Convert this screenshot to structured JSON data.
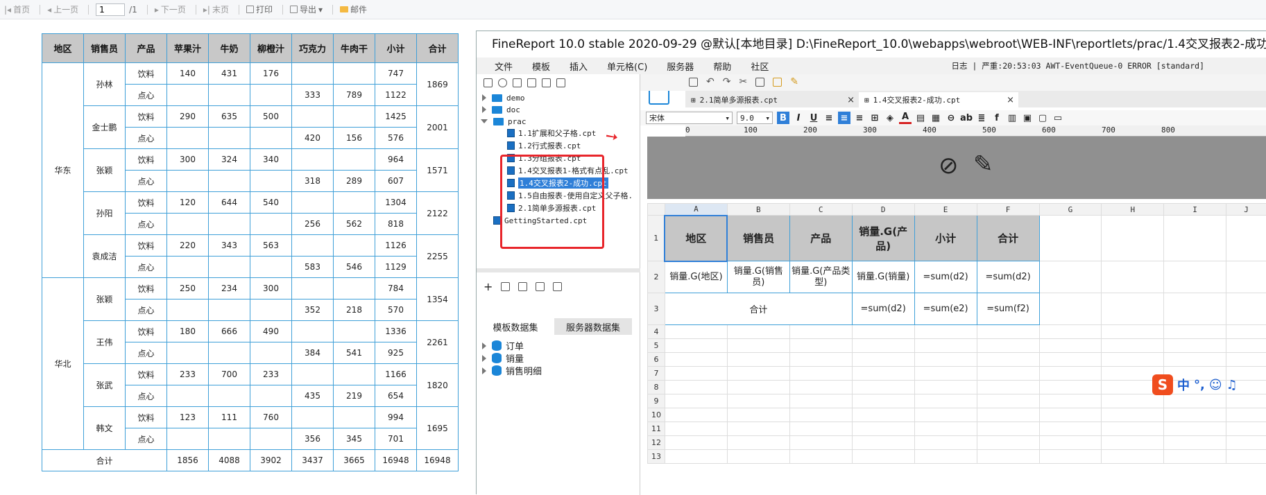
{
  "toolbar": {
    "first": "首页",
    "prev": "上一页",
    "page": "1",
    "total": "/1",
    "next": "下一页",
    "last": "末页",
    "print": "打印",
    "export": "导出",
    "mail": "邮件"
  },
  "report": {
    "headers": [
      "地区",
      "销售员",
      "产品",
      "苹果汁",
      "牛奶",
      "柳橙汁",
      "巧克力",
      "牛肉干",
      "小计",
      "合计"
    ],
    "regions": [
      {
        "name": "华东",
        "people": [
          {
            "name": "孙林",
            "total": "1869",
            "rows": [
              [
                "饮料",
                "140",
                "431",
                "176",
                "",
                "",
                "747"
              ],
              [
                "点心",
                "",
                "",
                "",
                "333",
                "789",
                "1122"
              ]
            ]
          },
          {
            "name": "金士鹏",
            "total": "2001",
            "rows": [
              [
                "饮料",
                "290",
                "635",
                "500",
                "",
                "",
                "1425"
              ],
              [
                "点心",
                "",
                "",
                "",
                "420",
                "156",
                "576"
              ]
            ]
          },
          {
            "name": "张颖",
            "total": "1571",
            "rows": [
              [
                "饮料",
                "300",
                "324",
                "340",
                "",
                "",
                "964"
              ],
              [
                "点心",
                "",
                "",
                "",
                "318",
                "289",
                "607"
              ]
            ]
          },
          {
            "name": "孙阳",
            "total": "2122",
            "rows": [
              [
                "饮料",
                "120",
                "644",
                "540",
                "",
                "",
                "1304"
              ],
              [
                "点心",
                "",
                "",
                "",
                "256",
                "562",
                "818"
              ]
            ]
          },
          {
            "name": "袁成洁",
            "total": "2255",
            "rows": [
              [
                "饮料",
                "220",
                "343",
                "563",
                "",
                "",
                "1126"
              ],
              [
                "点心",
                "",
                "",
                "",
                "583",
                "546",
                "1129"
              ]
            ]
          }
        ]
      },
      {
        "name": "华北",
        "people": [
          {
            "name": "张颖",
            "total": "1354",
            "rows": [
              [
                "饮料",
                "250",
                "234",
                "300",
                "",
                "",
                "784"
              ],
              [
                "点心",
                "",
                "",
                "",
                "352",
                "218",
                "570"
              ]
            ]
          },
          {
            "name": "王伟",
            "total": "2261",
            "rows": [
              [
                "饮料",
                "180",
                "666",
                "490",
                "",
                "",
                "1336"
              ],
              [
                "点心",
                "",
                "",
                "",
                "384",
                "541",
                "925"
              ]
            ]
          },
          {
            "name": "张武",
            "total": "1820",
            "rows": [
              [
                "饮料",
                "233",
                "700",
                "233",
                "",
                "",
                "1166"
              ],
              [
                "点心",
                "",
                "",
                "",
                "435",
                "219",
                "654"
              ]
            ]
          },
          {
            "name": "韩文",
            "total": "1695",
            "rows": [
              [
                "饮料",
                "123",
                "111",
                "760",
                "",
                "",
                "994"
              ],
              [
                "点心",
                "",
                "",
                "",
                "356",
                "345",
                "701"
              ]
            ]
          }
        ]
      }
    ],
    "footer": {
      "label": "合计",
      "values": [
        "1856",
        "4088",
        "3902",
        "3437",
        "3665",
        "16948",
        "16948"
      ]
    }
  },
  "designer": {
    "title": "FineReport 10.0 stable 2020-09-29 @默认[本地目录]     D:\\FineReport_10.0\\webapps\\webroot\\WEB-INF\\reportlets/prac/1.4交叉报表2-成功.cpt",
    "menus": [
      "文件",
      "模板",
      "插入",
      "单元格(C)",
      "服务器",
      "帮助",
      "社区"
    ],
    "status": "日志 | 严重:20:53:03 AWT-EventQueue-0 ERROR [standard]",
    "tree": {
      "folders": [
        "demo",
        "doc",
        "prac"
      ],
      "files": [
        "1.1扩展和父子格.cpt",
        "1.2行式报表.cpt",
        "1.3分组报表.cpt",
        "1.4交叉报表1-格式有点乱.cpt",
        "1.4交叉报表2-成功.cpt",
        "1.5自由报表-使用自定义父子格.",
        "2.1简单多源报表.cpt"
      ],
      "root_file": "GettingStarted.cpt"
    },
    "dataset_tabs": [
      "模板数据集",
      "服务器数据集"
    ],
    "datasets": [
      "订单",
      "销量",
      "销售明细"
    ],
    "file_tabs": [
      "2.1简单多源报表.cpt",
      "1.4交叉报表2-成功.cpt"
    ],
    "font": "宋体",
    "font_size": "9.0",
    "ruler": [
      "0",
      "100",
      "200",
      "300",
      "400",
      "500",
      "600",
      "700",
      "800"
    ],
    "columns": [
      "A",
      "B",
      "C",
      "D",
      "E",
      "F",
      "G",
      "H",
      "I",
      "J"
    ],
    "rows": [
      "1",
      "2",
      "3",
      "4",
      "5",
      "6",
      "7",
      "8",
      "9",
      "10",
      "11",
      "12",
      "13"
    ],
    "cells": {
      "r1": [
        "地区",
        "销售员",
        "产品",
        "销量.G(产品)",
        "小计",
        "合计"
      ],
      "r2": [
        "销量.G(地区)",
        "销量.G(销售员)",
        "销量.G(产品类型)",
        "销量.G(销量)",
        "=sum(d2)",
        "=sum(d2)"
      ],
      "r3": [
        "合计",
        "=sum(d2)",
        "=sum(e2)",
        "=sum(f2)"
      ]
    },
    "ime_label": "中"
  }
}
